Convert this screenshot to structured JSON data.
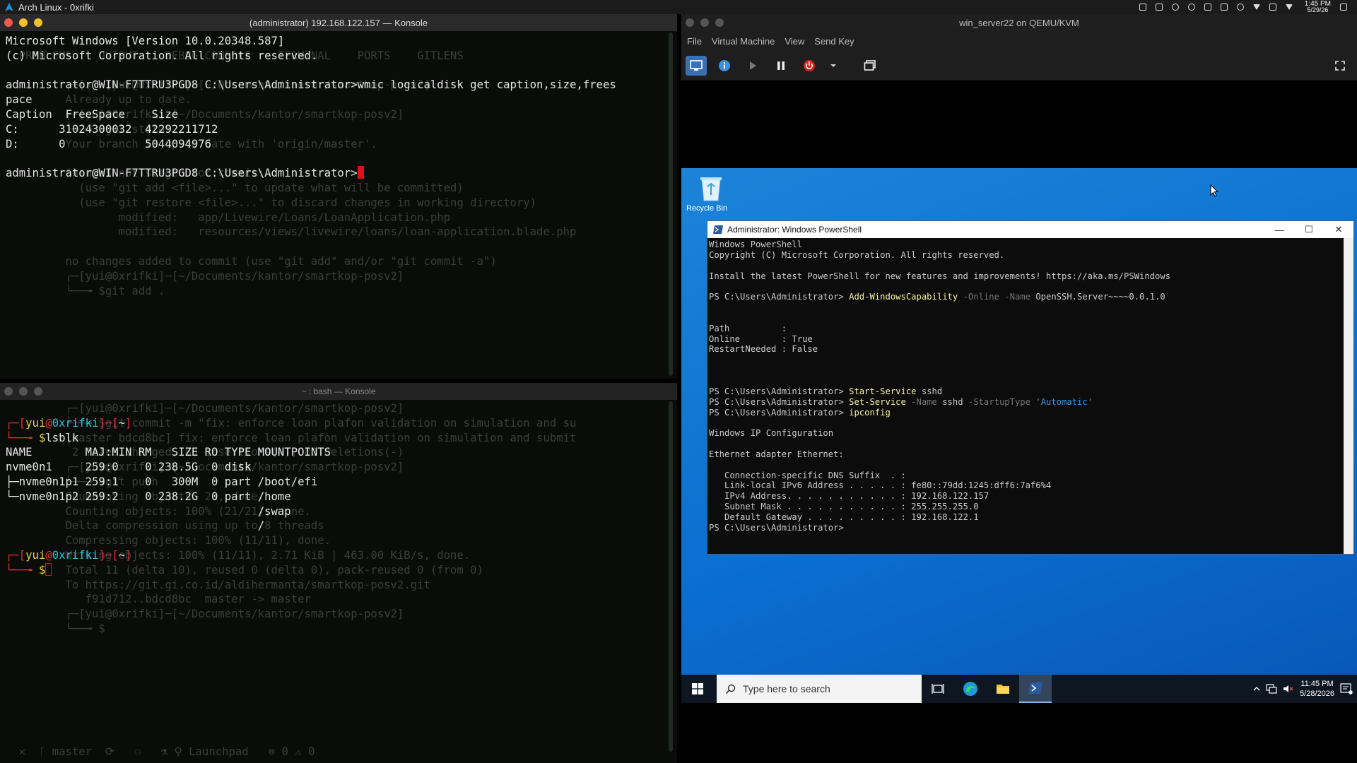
{
  "top_panel": {
    "title": "Arch Linux - 0xrifki",
    "clock_time": "1:45 PM",
    "clock_date": "5/29/26"
  },
  "konsole1": {
    "title": "(administrator) 192.168.122.157 — Konsole",
    "lines": [
      "Microsoft Windows [Version 10.0.20348.587]",
      "(c) Microsoft Corporation. All rights reserved.",
      "",
      "administrator@WIN-F7TTRU3PGD8 C:\\Users\\Administrator>wmic logicaldisk get caption,size,frees",
      "pace",
      "Caption  FreeSpace    Size",
      "C:      31024300032  42292211712",
      "D:      0            5044094976",
      ""
    ],
    "prompt": "administrator@WIN-F7TTRU3PGD8 C:\\Users\\Administrator>",
    "ghost_lines": [
      "",
      "  PROBLEMS    OUTPUT    DEBUG CONSOLE    TERMINAL    PORTS    GITLENS",
      "",
      "         ┌─[✗]─[yui@0xrifki]─[~/Documents/kantor/smartkop-posv2]",
      "         Already up to date.",
      "         ┌─[yui@0xrifki]─[~/Documents/kantor/smartkop-posv2]",
      "         └──╼ $git status",
      "         Your branch is up to date with 'origin/master'.",
      "",
      "         Changes not staged for commit:",
      "           (use \"git add <file>...\" to update what will be committed)",
      "           (use \"git restore <file>...\" to discard changes in working directory)",
      "                 modified:   app/Livewire/Loans/LoanApplication.php",
      "                 modified:   resources/views/livewire/loans/loan-application.blade.php",
      "",
      "         no changes added to commit (use \"git add\" and/or \"git commit -a\")",
      "         ┌─[yui@0xrifki]─[~/Documents/kantor/smartkop-posv2]",
      "         └──╼ $git add ."
    ]
  },
  "konsole2": {
    "title": "~ : bash — Konsole",
    "prompt_user": "yui",
    "prompt_host": "0xrifki",
    "prompt_dir": "~",
    "command": "lsblk",
    "lsblk_lines": [
      "NAME        MAJ:MIN RM   SIZE RO TYPE MOUNTPOINTS",
      "nvme0n1     259:0    0 238.5G  0 disk",
      "├─nvme0n1p1 259:1    0   300M  0 part /boot/efi",
      "└─nvme0n1p2 259:2    0 238.2G  0 part /home",
      "                                      /swap",
      "                                      /"
    ],
    "ghost_lines": [
      "         ┌─[yui@0xrifki]─[~/Documents/kantor/smartkop-posv2]",
      "         └──╼ $git commit -m \"fix: enforce loan plafon validation on simulation and su",
      "         [master bdcd8bc] fix: enforce loan plafon validation on simulation and submit",
      "          2 files changed, 83 insertions(+), 80 deletions(-)",
      "         ┌─[yui@0xrifki]─[~/Documents/kantor/smartkop-posv2]",
      "         └──╼ $git push",
      "         Enumerating objects: 21, done.",
      "         Counting objects: 100% (21/21), done.",
      "         Delta compression using up to 8 threads",
      "         Compressing objects: 100% (11/11), done.",
      "         Writing objects: 100% (11/11), 2.71 KiB | 463.00 KiB/s, done.",
      "         Total 11 (delta 10), reused 0 (delta 0), pack-reused 0 (from 0)",
      "         To https://git.gi.co.id/aldihermanta/smartkop-posv2.git",
      "            f91d712..bdcd8bc  master -> master",
      "         ┌─[yui@0xrifki]─[~/Documents/kantor/smartkop-posv2]",
      "         └──╼ $"
    ],
    "status_bar": "  ✕  ᚴ master  ⟳   ⚇   ⚗ ⚲ Launchpad   ⊗ 0 ⚠ 0"
  },
  "vm": {
    "title": "win_server22 on QEMU/KVM",
    "menu": [
      "File",
      "Virtual Machine",
      "View",
      "Send Key"
    ],
    "recycle_bin": "Recycle Bin",
    "powershell": {
      "title": "Administrator: Windows PowerShell",
      "header1": "Windows PowerShell",
      "header2": "Copyright (C) Microsoft Corporation. All rights reserved.",
      "header3": "Install the latest PowerShell for new features and improvements! https://aka.ms/PSWindows",
      "prompt": "PS C:\\Users\\Administrator> ",
      "cmd1_name": "Add-WindowsCapability",
      "cmd1_p1": "-Online",
      "cmd1_p2": "-Name",
      "cmd1_arg": "OpenSSH.Server~~~~0.0.1.0",
      "out_path": "Path          :",
      "out_online": "Online        : True",
      "out_restart": "RestartNeeded : False",
      "cmd2_name": "Start-Service",
      "cmd2_arg": "sshd",
      "cmd3_name": "Set-Service",
      "cmd3_p1": "-Name",
      "cmd3_arg": "sshd",
      "cmd3_p2": "-StartupType",
      "cmd3_str": "'Automatic'",
      "cmd4_name": "ipconfig",
      "ipconfig_title": "Windows IP Configuration",
      "adapter": "Ethernet adapter Ethernet:",
      "dns": "   Connection-specific DNS Suffix  . :",
      "ipv6": "   Link-local IPv6 Address . . . . . : fe80::79dd:1245:dff6:7af6%4",
      "ipv4": "   IPv4 Address. . . . . . . . . . . : 192.168.122.157",
      "mask": "   Subnet Mask . . . . . . . . . . . : 255.255.255.0",
      "gateway": "   Default Gateway . . . . . . . . . : 192.168.122.1"
    },
    "taskbar": {
      "search_placeholder": "Type here to search",
      "time": "11:45 PM",
      "date": "5/28/2026"
    }
  }
}
